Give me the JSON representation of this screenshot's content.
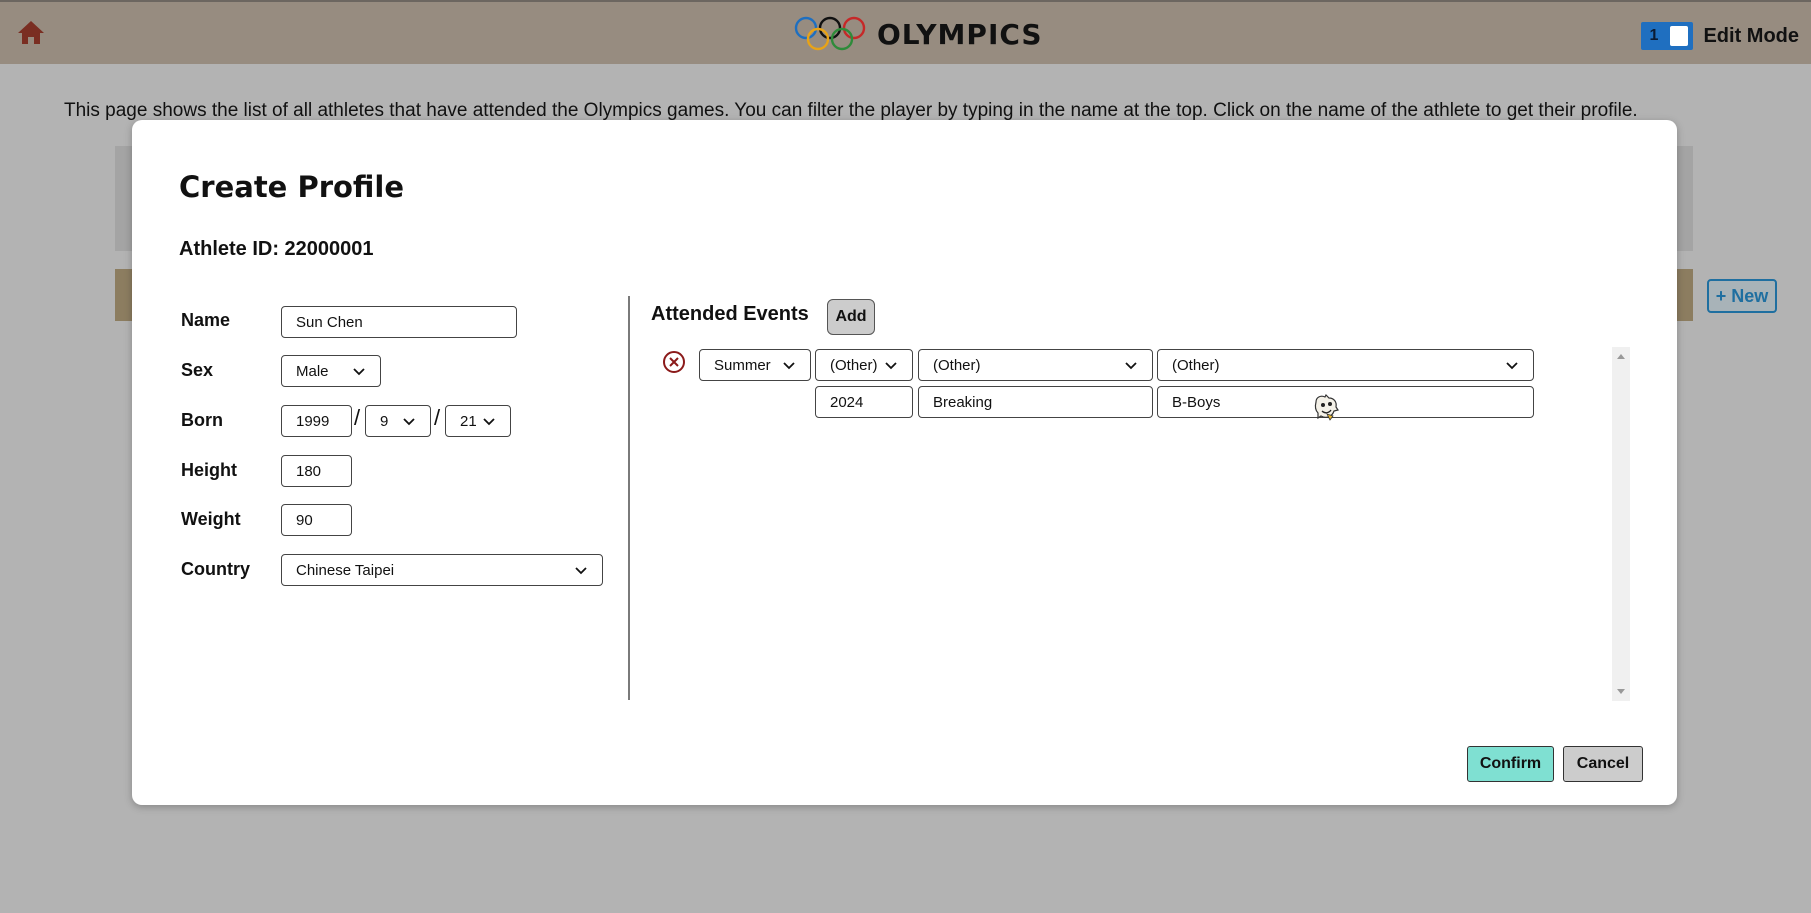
{
  "header": {
    "title": "OLYMPICS",
    "edit_toggle_value": "1",
    "edit_mode_label": "Edit Mode"
  },
  "page": {
    "info_text": "This page shows the list of all athletes that have attended the Olympics games. You can filter the player by typing in the name at the top. Click on the name of the athlete to get their profile.",
    "new_button_label": "+ New"
  },
  "modal": {
    "title": "Create Profile",
    "athlete_id_label": "Athlete ID: 22000001",
    "form": {
      "name_label": "Name",
      "name_value": "Sun Chen",
      "sex_label": "Sex",
      "sex_value": "Male",
      "born_label": "Born",
      "born_year": "1999",
      "born_month": "9",
      "born_day": "21",
      "born_separator": "/",
      "height_label": "Height",
      "height_value": "180",
      "weight_label": "Weight",
      "weight_value": "90",
      "country_label": "Country",
      "country_value": "Chinese Taipei"
    },
    "events": {
      "title": "Attended Events",
      "add_label": "Add",
      "rows": [
        {
          "season": "Summer",
          "year_select": "(Other)",
          "sport_select": "(Other)",
          "event_select": "(Other)",
          "year_input": "2024",
          "sport_input": "Breaking",
          "event_input": "B-Boys"
        }
      ]
    },
    "confirm_label": "Confirm",
    "cancel_label": "Cancel"
  },
  "colors": {
    "topbar": "#978c80",
    "overlay": "#b3b3b3",
    "toggle": "#1f6fc0",
    "confirm": "#7fe0d2",
    "remove_icon": "#8b1a1a"
  }
}
